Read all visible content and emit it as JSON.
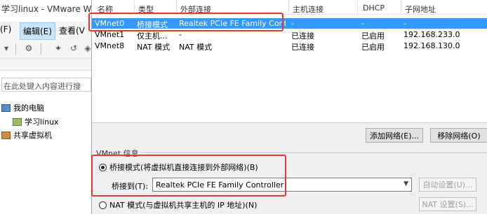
{
  "background_window": {
    "title": "学习linux - VMware W",
    "menu": {
      "file": "(F)",
      "edit": "编辑(E)",
      "view": "查看(V"
    },
    "search_placeholder": "在此处键入内容进行搜",
    "tree": {
      "my_computer": "我的电脑",
      "vm_name": "学习linux",
      "shared_vms": "共享虚拟机"
    }
  },
  "dialog": {
    "table": {
      "headers": {
        "name": "名称",
        "type": "类型",
        "external": "外部连接",
        "host": "主机连接",
        "dhcp": "DHCP",
        "subnet": "子网地址"
      },
      "rows": [
        {
          "name": "VMnet0",
          "type": "桥接模式",
          "external": "Realtek PCIe FE Family Cont...",
          "host": "-",
          "dhcp": "-",
          "subnet": "-"
        },
        {
          "name": "VMnet1",
          "type": "仅主机...",
          "external": "-",
          "host": "已连接",
          "dhcp": "已启用",
          "subnet": "192.168.233.0"
        },
        {
          "name": "VMnet8",
          "type": "NAT 模式",
          "external": "NAT 模式",
          "host": "已连接",
          "dhcp": "已启用",
          "subnet": "192.168.130.0"
        }
      ]
    },
    "buttons": {
      "add_network": "添加网络(E)...",
      "remove_network": "移除网络(O)"
    },
    "info_group_label": "VMnet 信息",
    "bridged_radio_label": "桥接模式(将虚拟机直接连接到外部网络)(B)",
    "bridge_to_label": "桥接到(T):",
    "bridge_adapter": "Realtek PCIe FE Family Controller",
    "auto_settings_label": "自动设置(U)...",
    "nat_radio_label": "NAT 模式(与虚拟机共享主机的 IP 地址)(N)",
    "nat_settings_label": "NAT 设置(S)..."
  },
  "colors": {
    "selection": "#3399ff",
    "annotation": "#e53935"
  }
}
